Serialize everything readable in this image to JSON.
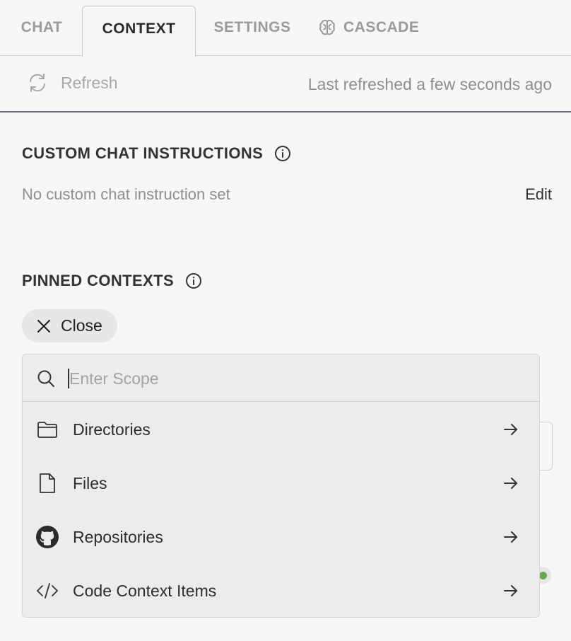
{
  "tabs": [
    {
      "label": "CHAT",
      "active": false
    },
    {
      "label": "CONTEXT",
      "active": true
    },
    {
      "label": "SETTINGS",
      "active": false
    },
    {
      "label": "CASCADE",
      "active": false,
      "icon": "brain-icon"
    }
  ],
  "refresh": {
    "button_label": "Refresh",
    "icon": "refresh-icon",
    "status": "Last refreshed a few seconds ago"
  },
  "custom_instructions": {
    "title": "CUSTOM CHAT INSTRUCTIONS",
    "info_icon": "info-icon",
    "empty_text": "No custom chat instruction set",
    "edit_label": "Edit"
  },
  "pinned_contexts": {
    "title": "PINNED CONTEXTS",
    "info_icon": "info-icon",
    "close_label": "Close"
  },
  "scope_dropdown": {
    "search_placeholder": "Enter Scope",
    "search_value": "",
    "items": [
      {
        "label": "Directories",
        "icon": "folder-icon"
      },
      {
        "label": "Files",
        "icon": "file-icon"
      },
      {
        "label": "Repositories",
        "icon": "github-icon"
      },
      {
        "label": "Code Context Items",
        "icon": "code-icon"
      }
    ]
  },
  "colors": {
    "background": "#f7f7f7",
    "dropdown_bg": "#ececee",
    "status_dot": "#6aa84f"
  }
}
